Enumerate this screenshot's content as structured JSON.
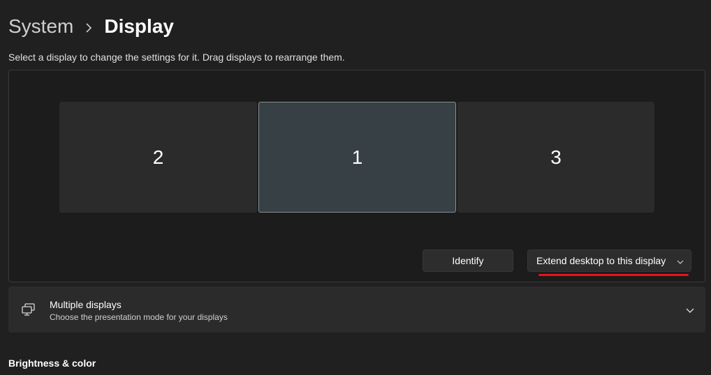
{
  "breadcrumb": {
    "parent": "System",
    "current": "Display"
  },
  "instructions": "Select a display to change the settings for it. Drag displays to rearrange them.",
  "monitors": [
    {
      "label": "2",
      "selected": false
    },
    {
      "label": "1",
      "selected": true
    },
    {
      "label": "3",
      "selected": false
    }
  ],
  "identify_label": "Identify",
  "display_mode_select": {
    "selected": "Extend desktop to this display"
  },
  "multiple_displays": {
    "title": "Multiple displays",
    "subtitle": "Choose the presentation mode for your displays",
    "icon": "multiple-displays-icon"
  },
  "brightness_heading": "Brightness & color",
  "colors": {
    "background": "#202020",
    "selected_monitor": "#374145",
    "annotation_underline": "#e8131b"
  }
}
